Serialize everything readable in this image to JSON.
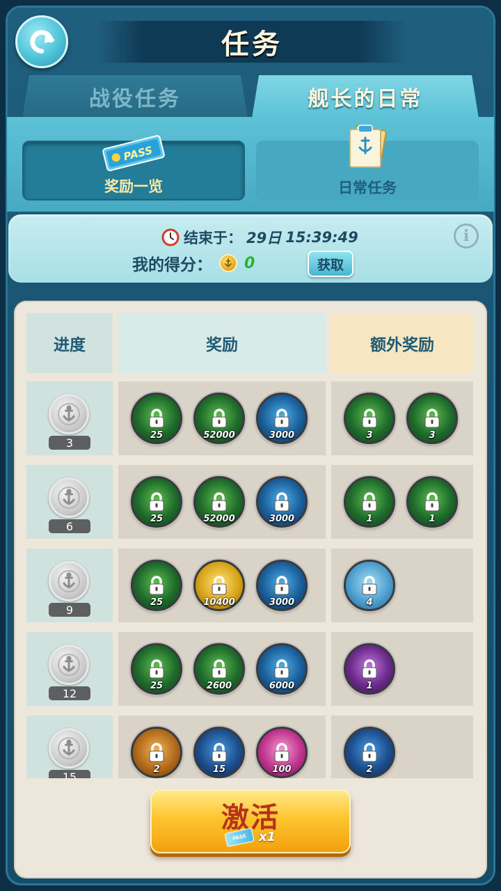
{
  "header": {
    "title": "任务"
  },
  "tabs": [
    {
      "label": "战役任务",
      "active": false
    },
    {
      "label": "舰长的日常",
      "active": true
    }
  ],
  "sub_tabs": [
    {
      "label": "奖励一览",
      "icon": "pass-ticket-icon",
      "active": true,
      "icon_text": "PASS"
    },
    {
      "label": "日常任务",
      "icon": "clipboard-icon",
      "active": false
    }
  ],
  "info": {
    "end_label": "结束于：",
    "end_days": "29日",
    "end_time": "15:39:49",
    "score_label": "我的得分：",
    "score_value": "0",
    "get_button": "获取"
  },
  "table": {
    "headers": {
      "progress": "进度",
      "reward": "奖励",
      "extra": "额外奖励"
    },
    "rows": [
      {
        "level": "3",
        "rewards": [
          {
            "icon": "repair-kit-icon",
            "qty": "25",
            "color": "green"
          },
          {
            "icon": "gold-bars-icon",
            "qty": "52000",
            "color": "green"
          },
          {
            "icon": "exp-icon",
            "qty": "3000",
            "color": "blue"
          }
        ],
        "extras": [
          {
            "icon": "warship-icon",
            "qty": "3",
            "color": "green"
          },
          {
            "icon": "porthole-icon",
            "qty": "3",
            "color": "green"
          }
        ]
      },
      {
        "level": "6",
        "rewards": [
          {
            "icon": "warship-icon",
            "qty": "25",
            "color": "green"
          },
          {
            "icon": "cannon-icon",
            "qty": "52000",
            "color": "green"
          },
          {
            "icon": "exp-icon",
            "qty": "3000",
            "color": "blue"
          }
        ],
        "extras": [
          {
            "icon": "gold-bars-icon",
            "qty": "1",
            "color": "green"
          },
          {
            "icon": "cannon-icon",
            "qty": "1",
            "color": "green"
          }
        ]
      },
      {
        "level": "9",
        "rewards": [
          {
            "icon": "bomb-icon",
            "qty": "25",
            "color": "green"
          },
          {
            "icon": "gold-coin-icon",
            "qty": "10400",
            "color": "yellow"
          },
          {
            "icon": "exp-icon",
            "qty": "3000",
            "color": "blue"
          }
        ],
        "extras": [
          {
            "icon": "blueprint-icon",
            "qty": "4",
            "color": "lightblue"
          }
        ]
      },
      {
        "level": "12",
        "rewards": [
          {
            "icon": "torpedo-icon",
            "qty": "25",
            "color": "green"
          },
          {
            "icon": "steel-ingot-icon",
            "qty": "2600",
            "color": "green"
          },
          {
            "icon": "exp-icon",
            "qty": "6000",
            "color": "blue"
          }
        ],
        "extras": [
          {
            "icon": "emerald-icon",
            "qty": "1",
            "color": "purple"
          }
        ]
      },
      {
        "level": "15",
        "rewards": [
          {
            "icon": "map-scroll-icon",
            "qty": "2",
            "color": "orange"
          },
          {
            "icon": "blue-gem-icon",
            "qty": "15",
            "color": "darkblue"
          },
          {
            "icon": "pink-gem-icon",
            "qty": "100",
            "color": "pink"
          }
        ],
        "extras": [
          {
            "icon": "blue-card-icon",
            "qty": "2",
            "color": "darkblue"
          }
        ]
      }
    ]
  },
  "activate": {
    "label": "激活",
    "count": "x1",
    "ticket_text": "PASS"
  },
  "colors": {
    "frame": "#1a5572",
    "tab_active": "#5cc2d6",
    "accent_yellow": "#fdc52e",
    "activate_text": "#b5331a",
    "score_green": "#2db52a"
  }
}
